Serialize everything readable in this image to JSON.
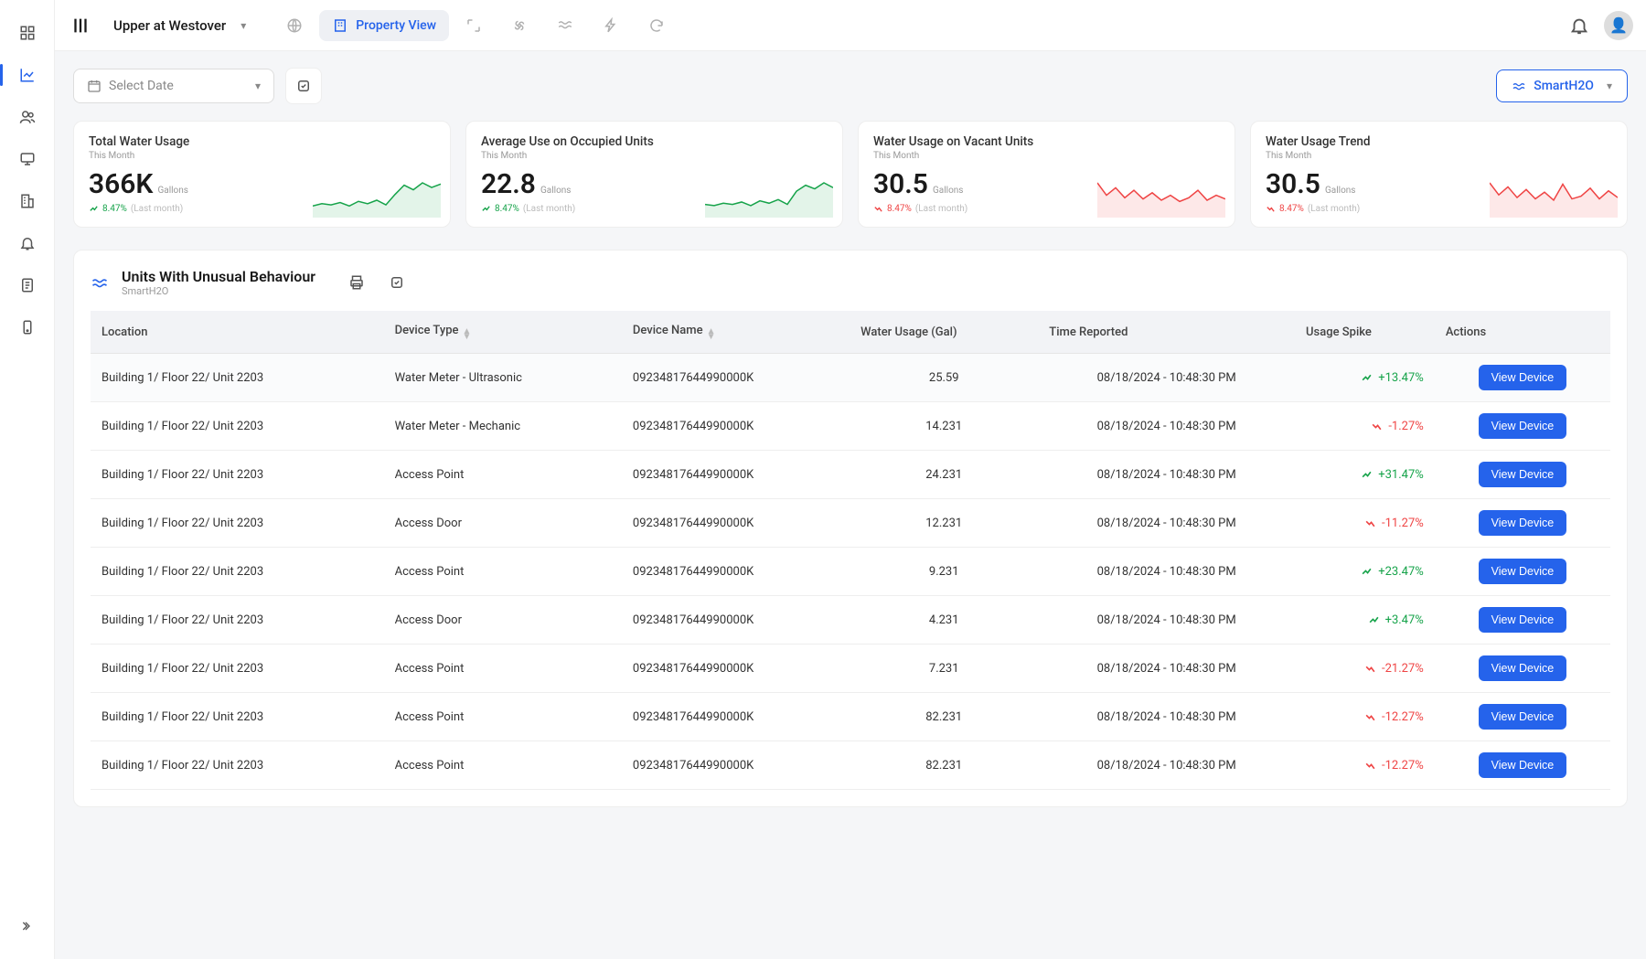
{
  "topbar": {
    "property_name": "Upper at Westover",
    "active_tab": "Property View"
  },
  "filters": {
    "date_placeholder": "Select Date",
    "smart_label": "SmartH2O"
  },
  "cards": [
    {
      "title": "Total Water Usage",
      "sub": "This Month",
      "value": "366K",
      "unit": "Gallons",
      "change": "8.47%",
      "period": "(Last month)",
      "dir": "up"
    },
    {
      "title": "Average Use on Occupied Units",
      "sub": "This Month",
      "value": "22.8",
      "unit": "Gallons",
      "change": "8.47%",
      "period": "(Last month)",
      "dir": "up"
    },
    {
      "title": "Water Usage on Vacant Units",
      "sub": "This Month",
      "value": "30.5",
      "unit": "Gallons",
      "change": "8.47%",
      "period": "(Last month)",
      "dir": "down"
    },
    {
      "title": "Water Usage Trend",
      "sub": "This Month",
      "value": "30.5",
      "unit": "Gallons",
      "change": "8.47%",
      "period": "(Last month)",
      "dir": "down"
    }
  ],
  "panel": {
    "title": "Units With Unusual Behaviour",
    "sub": "SmartH2O",
    "columns": [
      "Location",
      "Device Type",
      "Device Name",
      "Water Usage (Gal)",
      "Time Reported",
      "Usage Spike",
      "Actions"
    ],
    "action_label": "View Device",
    "rows": [
      {
        "location": "Building 1/ Floor 22/ Unit 2203",
        "device_type": "Water Meter - Ultrasonic",
        "device_name": "09234817644990000K",
        "usage": "25.59",
        "time": "08/18/2024 - 10:48:30 PM",
        "spike": "+13.47%",
        "dir": "up"
      },
      {
        "location": "Building 1/ Floor 22/ Unit 2203",
        "device_type": "Water Meter - Mechanic",
        "device_name": "09234817644990000K",
        "usage": "14.231",
        "time": "08/18/2024 - 10:48:30 PM",
        "spike": "-1.27%",
        "dir": "down"
      },
      {
        "location": "Building 1/ Floor 22/ Unit 2203",
        "device_type": "Access Point",
        "device_name": "09234817644990000K",
        "usage": "24.231",
        "time": "08/18/2024 - 10:48:30 PM",
        "spike": "+31.47%",
        "dir": "up"
      },
      {
        "location": "Building 1/ Floor 22/ Unit 2203",
        "device_type": "Access Door",
        "device_name": "09234817644990000K",
        "usage": "12.231",
        "time": "08/18/2024 - 10:48:30 PM",
        "spike": "-11.27%",
        "dir": "down"
      },
      {
        "location": "Building 1/ Floor 22/ Unit 2203",
        "device_type": "Access Point",
        "device_name": "09234817644990000K",
        "usage": "9.231",
        "time": "08/18/2024 - 10:48:30 PM",
        "spike": "+23.47%",
        "dir": "up"
      },
      {
        "location": "Building 1/ Floor 22/ Unit 2203",
        "device_type": "Access Door",
        "device_name": "09234817644990000K",
        "usage": "4.231",
        "time": "08/18/2024 - 10:48:30 PM",
        "spike": "+3.47%",
        "dir": "up"
      },
      {
        "location": "Building 1/ Floor 22/ Unit 2203",
        "device_type": "Access Point",
        "device_name": "09234817644990000K",
        "usage": "7.231",
        "time": "08/18/2024 - 10:48:30 PM",
        "spike": "-21.27%",
        "dir": "down"
      },
      {
        "location": "Building 1/ Floor 22/ Unit 2203",
        "device_type": "Access Point",
        "device_name": "09234817644990000K",
        "usage": "82.231",
        "time": "08/18/2024 - 10:48:30 PM",
        "spike": "-12.27%",
        "dir": "down"
      },
      {
        "location": "Building 1/ Floor 22/ Unit 2203",
        "device_type": "Access Point",
        "device_name": "09234817644990000K",
        "usage": "82.231",
        "time": "08/18/2024 - 10:48:30 PM",
        "spike": "-12.27%",
        "dir": "down"
      }
    ]
  },
  "chart_data": [
    {
      "type": "line",
      "title": "Total Water Usage sparkline",
      "color": "#16a34a",
      "values": [
        10,
        12,
        11,
        13,
        10,
        14,
        12,
        15,
        11,
        20,
        28,
        24,
        30,
        26,
        29
      ]
    },
    {
      "type": "line",
      "title": "Average Use sparkline",
      "color": "#16a34a",
      "values": [
        11,
        10,
        12,
        11,
        13,
        10,
        14,
        12,
        15,
        11,
        22,
        27,
        24,
        29,
        25
      ]
    },
    {
      "type": "line",
      "title": "Vacant Units sparkline",
      "color": "#ef4444",
      "values": [
        28,
        18,
        24,
        16,
        22,
        15,
        20,
        14,
        18,
        13,
        16,
        22,
        14,
        18,
        15
      ]
    },
    {
      "type": "line",
      "title": "Usage Trend sparkline",
      "color": "#ef4444",
      "values": [
        26,
        17,
        23,
        15,
        21,
        14,
        19,
        13,
        25,
        14,
        16,
        22,
        14,
        20,
        15
      ]
    }
  ]
}
